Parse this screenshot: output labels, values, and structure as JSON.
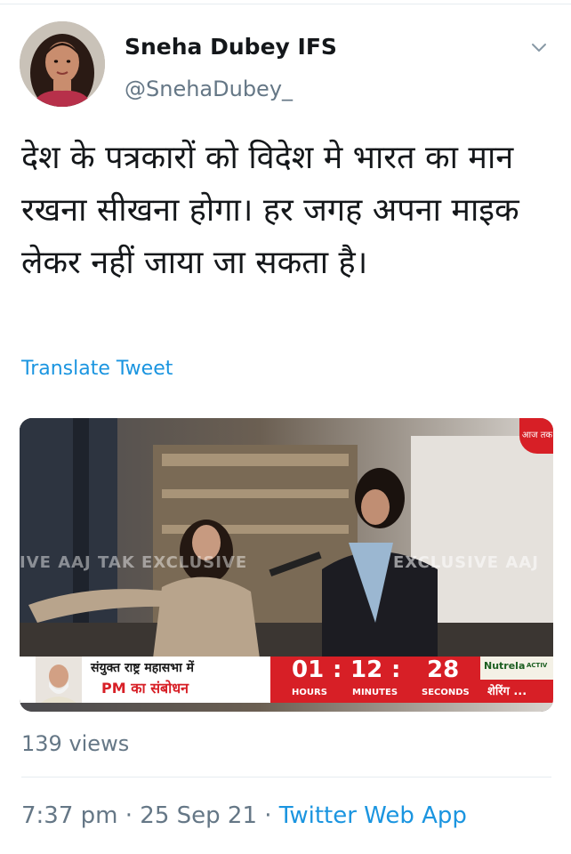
{
  "tweet": {
    "author_name": "Sneha Dubey IFS",
    "author_handle": "@SnehaDubey_",
    "text": "देश के पत्रकारों को विदेश मे भारत का मान रखना सीखना होगा। हर जगह अपना माइक लेकर नहीं जाया जा सकता है।",
    "translate_label": "Translate Tweet",
    "views_label": "139 views",
    "time": "7:37 pm",
    "date": "25 Sep 21",
    "separator": "·",
    "source": "Twitter Web App"
  },
  "video": {
    "channel_logo_text": "आज तक",
    "watermark_left": "IVE AAJ TAK EXCLUSIVE",
    "watermark_right": "EXCLUSIVE AAJ",
    "lower_third_line1": "संयुक्त राष्ट्र महासभा में",
    "lower_third_line2": "PM का संबोधन",
    "countdown_hours": "01",
    "countdown_minutes": "12",
    "countdown_seconds": "28",
    "colon": ":",
    "label_hours": "HOURS",
    "label_minutes": "MINUTES",
    "label_seconds": "SECONDS",
    "sponsor": "Nutrela",
    "sponsor_sub": "ACTIV",
    "ticker": "शेरिंग ..."
  },
  "icons": {
    "caret": "chevron-down-icon",
    "avatar": "avatar"
  },
  "colors": {
    "link": "#1b95e0",
    "secondary_text": "#657786",
    "primary_text": "#14171a",
    "aajtak_red": "#d71f26"
  }
}
